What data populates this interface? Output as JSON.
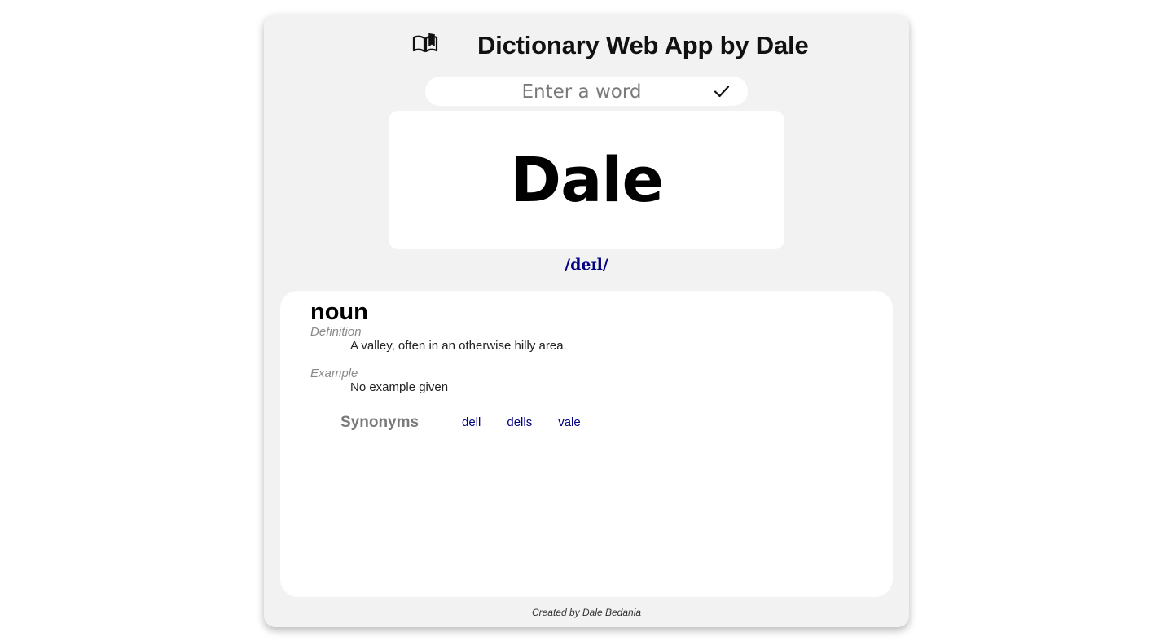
{
  "header": {
    "icon": "open-book-icon",
    "title": "Dictionary Web App by Dale"
  },
  "search": {
    "placeholder": "Enter a word",
    "value": "",
    "submit_icon": "checkmark-icon"
  },
  "result": {
    "word": "Dale",
    "phonetic": "/deɪl/"
  },
  "meaning": {
    "part_of_speech": "noun",
    "definition_label": "Definition",
    "definition": "A valley, often in an otherwise hilly area.",
    "example_label": "Example",
    "example": "No example given",
    "synonyms_label": "Synonyms",
    "synonyms": [
      "dell",
      "dells",
      "vale"
    ]
  },
  "footer": {
    "credit": "Created by Dale Bedania"
  },
  "colors": {
    "card_background": "#f2f2f2",
    "panel_background": "#ffffff",
    "phonetic_color": "#000080",
    "synonym_color": "#000080"
  }
}
